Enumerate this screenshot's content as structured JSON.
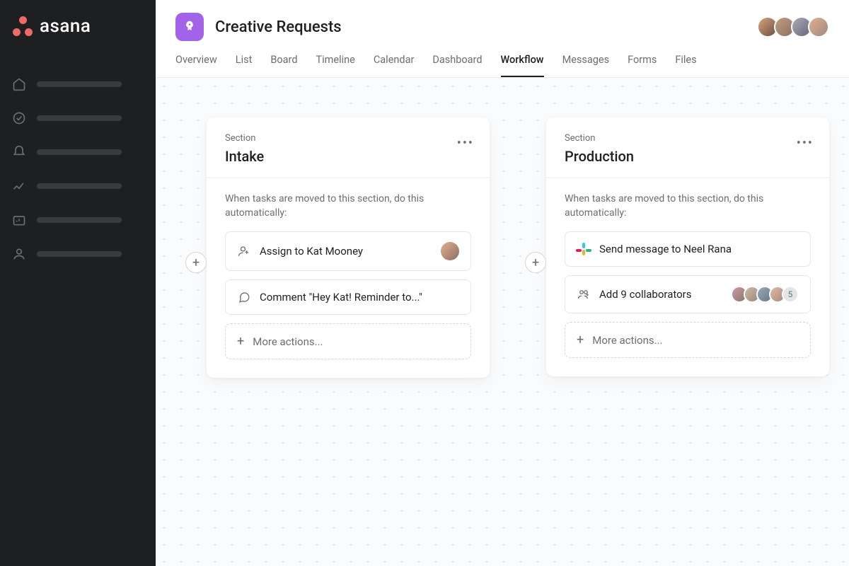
{
  "app": {
    "name": "asana"
  },
  "project": {
    "title": "Creative Requests",
    "icon_color": "#a362ea"
  },
  "tabs": [
    {
      "label": "Overview",
      "active": false
    },
    {
      "label": "List",
      "active": false
    },
    {
      "label": "Board",
      "active": false
    },
    {
      "label": "Timeline",
      "active": false
    },
    {
      "label": "Calendar",
      "active": false
    },
    {
      "label": "Dashboard",
      "active": false
    },
    {
      "label": "Workflow",
      "active": true
    },
    {
      "label": "Messages",
      "active": false
    },
    {
      "label": "Forms",
      "active": false
    },
    {
      "label": "Files",
      "active": false
    }
  ],
  "header_avatar_count": 4,
  "workflow": {
    "section_label": "Section",
    "automation_hint": "When tasks are moved to this section, do this automatically:",
    "more_actions_label": "More actions...",
    "sections": [
      {
        "name": "Intake",
        "rules": [
          {
            "icon": "assign",
            "text": "Assign to Kat Mooney",
            "has_avatar": true
          },
          {
            "icon": "comment",
            "text": "Comment \"Hey Kat! Reminder to...\""
          }
        ]
      },
      {
        "name": "Production",
        "rules": [
          {
            "icon": "slack",
            "text": "Send message to Neel Rana"
          },
          {
            "icon": "collaborators",
            "text": "Add 9 collaborators",
            "collaborator_avatars": 4,
            "overflow_count": "5"
          }
        ]
      }
    ]
  }
}
